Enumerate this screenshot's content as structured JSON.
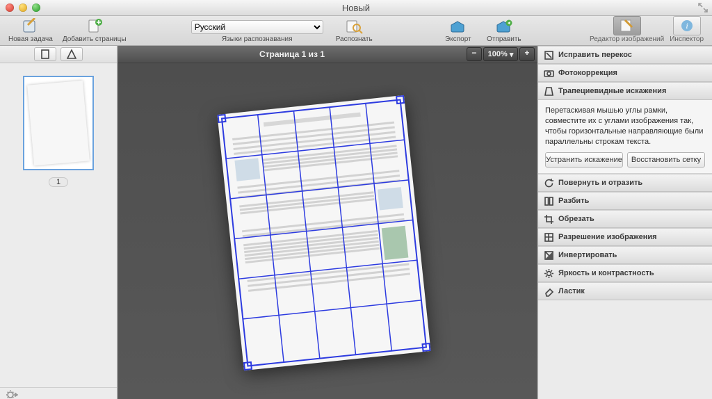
{
  "window": {
    "title": "Новый"
  },
  "toolbar": {
    "new_task": "Новая задача",
    "add_pages": "Добавить страницы",
    "lang_label": "Языки распознавания",
    "lang_value": "Русский",
    "recognize": "Распознать",
    "export": "Экспорт",
    "send": "Отправить",
    "image_editor": "Редактор изображений",
    "inspector": "Инспектор"
  },
  "thumbs": {
    "page_number": "1"
  },
  "canvas": {
    "page_label": "Страница 1 из 1",
    "zoom": "100%"
  },
  "right": {
    "deskew": "Исправить перекос",
    "photofix": "Фотокоррекция",
    "keystone": "Трапециевидные искажения",
    "keystone_body": "Перетаскивая мышью углы рамки, совместите их с углами изображения так, чтобы горизонтальные направляющие были параллельны строкам текста.",
    "btn_fix": "Устранить искажение",
    "btn_reset": "Восстановить сетку",
    "rotate": "Повернуть и отразить",
    "split": "Разбить",
    "crop": "Обрезать",
    "resolution": "Разрешение изображения",
    "invert": "Инвертировать",
    "brightness": "Яркость и контрастность",
    "eraser": "Ластик"
  }
}
